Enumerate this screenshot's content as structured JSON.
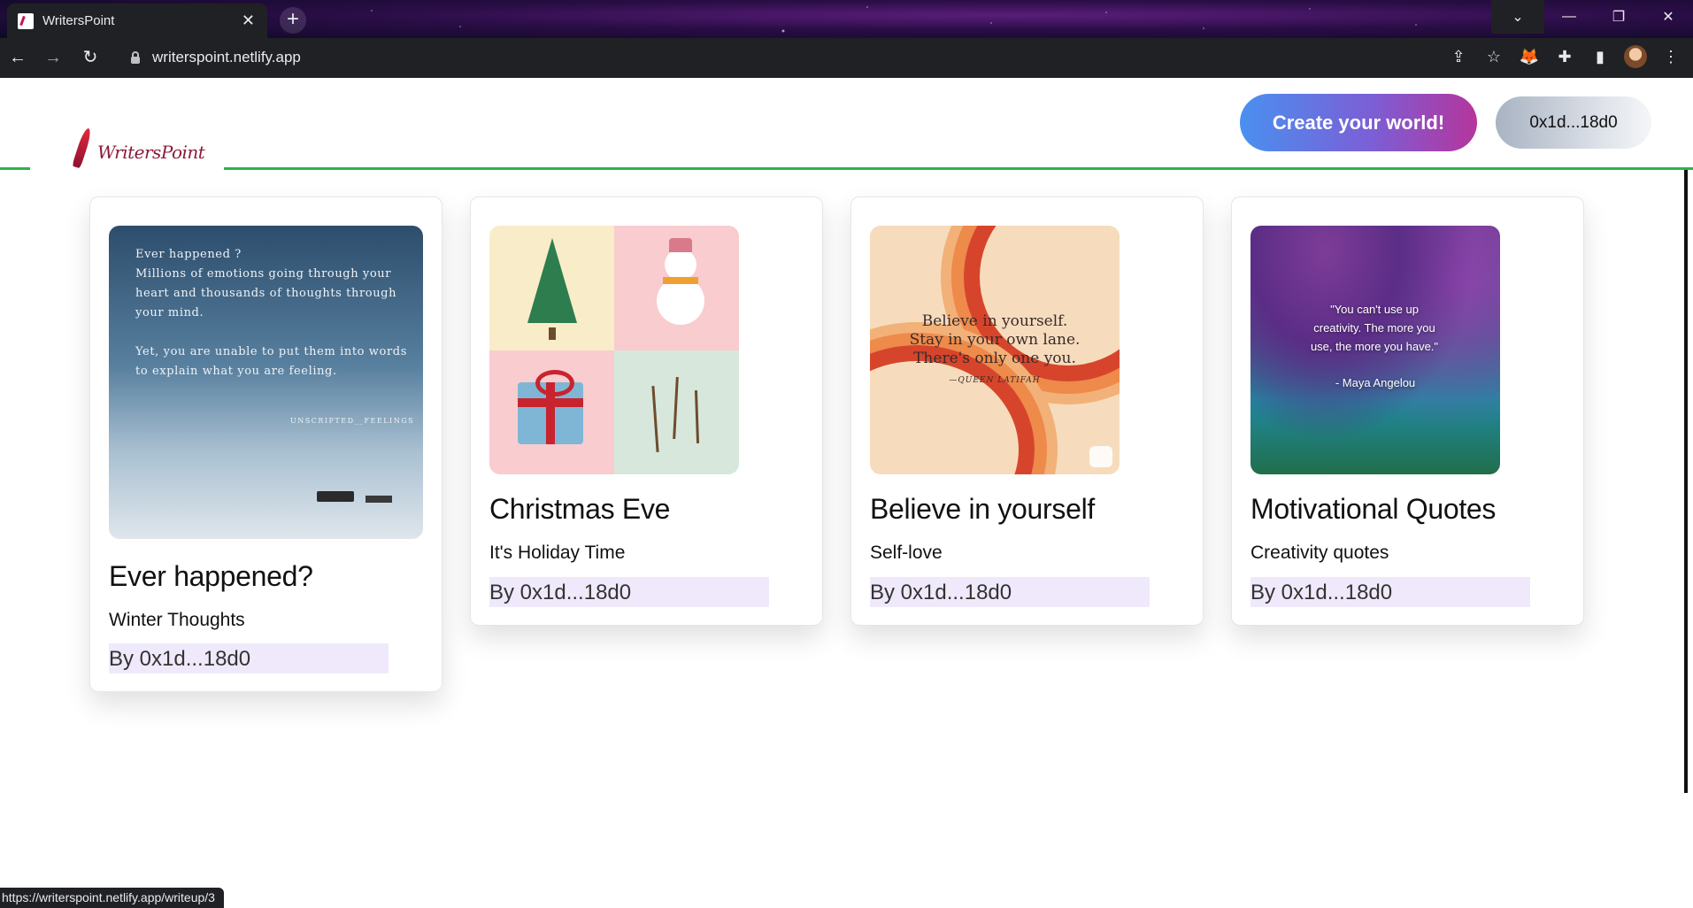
{
  "browser": {
    "tab_title": "WritersPoint",
    "tab_close": "✕",
    "new_tab": "+",
    "url": "writerspoint.netlify.app",
    "status_url": "https://writerspoint.netlify.app/writeup/3",
    "icons": {
      "back": "←",
      "forward": "→",
      "reload": "↻",
      "share": "⇪",
      "star": "☆",
      "extension_fox": "🦊",
      "extensions": "✚",
      "sidepanel": "▮",
      "menu": "⋮",
      "tab_search": "⌄",
      "minimize": "—",
      "restore": "❐",
      "close": "✕"
    }
  },
  "header": {
    "logo_text": "WritersPoint",
    "create_button": "Create your world!",
    "account_button": "0x1d...18d0",
    "line_color": "#2db34a"
  },
  "cards": [
    {
      "title": "Ever happened?",
      "subtitle": "Winter Thoughts",
      "author": "By 0x1d...18d0",
      "image_text": {
        "heading": "Ever happened ?",
        "p1a": "Millions of emotions going through your",
        "p1b": "heart and thousands of thoughts through",
        "p1c": "your mind.",
        "p2a": "Yet, you are unable to put them into words",
        "p2b": "to explain what you are feeling.",
        "signature": "UNSCRIPTED__FEELINGS"
      }
    },
    {
      "title": "Christmas Eve",
      "subtitle": "It's Holiday Time",
      "author": "By 0x1d...18d0"
    },
    {
      "title": "Believe in yourself",
      "subtitle": "Self-love",
      "author": "By 0x1d...18d0",
      "image_text": {
        "line1": "Believe in yourself.",
        "line2": "Stay in your own lane.",
        "line3": "There's only one you.",
        "attribution": "—QUEEN LATIFAH"
      }
    },
    {
      "title": "Motivational Quotes",
      "subtitle": "Creativity quotes",
      "author": "By 0x1d...18d0",
      "image_text": {
        "q1": "\"You can't use up",
        "q2": "creativity. The more you",
        "q3": "use, the more you have.\"",
        "attribution": "- Maya Angelou"
      }
    }
  ]
}
